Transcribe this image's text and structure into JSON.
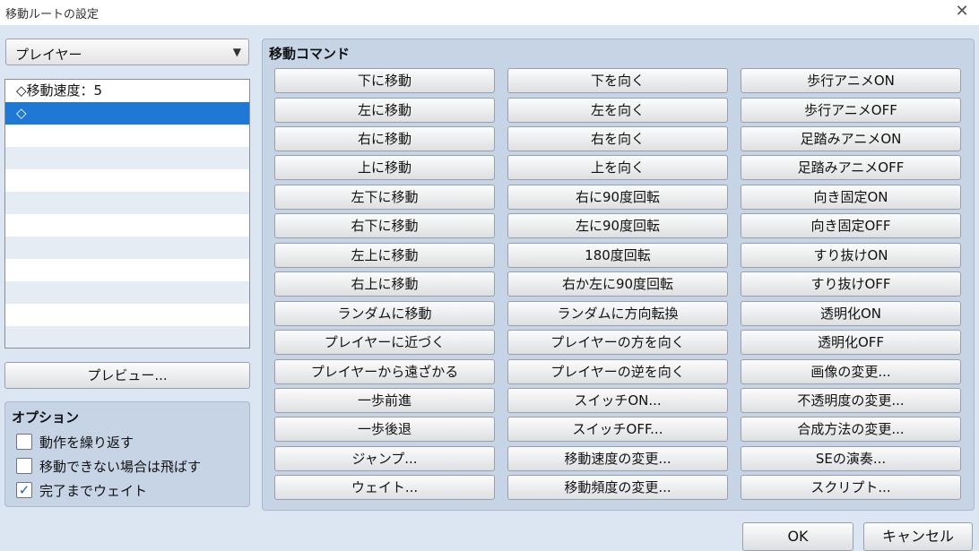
{
  "window": {
    "title": "移動ルートの設定",
    "close_glyph": "✕"
  },
  "target": {
    "selected": "プレイヤー",
    "arrow": "▼"
  },
  "route_list": {
    "items": [
      "◇移動速度：5",
      "◇",
      "",
      "",
      "",
      "",
      "",
      "",
      "",
      "",
      "",
      ""
    ],
    "selected_index": 1
  },
  "preview_label": "プレビュー...",
  "options": {
    "heading": "オプション",
    "items": [
      {
        "label": "動作を繰り返す",
        "checked": false
      },
      {
        "label": "移動できない場合は飛ばす",
        "checked": false
      },
      {
        "label": "完了までウェイト",
        "checked": true
      }
    ],
    "check_glyph": "✓"
  },
  "commands": {
    "heading": "移動コマンド",
    "columns": [
      [
        "下に移動",
        "左に移動",
        "右に移動",
        "上に移動",
        "左下に移動",
        "右下に移動",
        "左上に移動",
        "右上に移動",
        "ランダムに移動",
        "プレイヤーに近づく",
        "プレイヤーから遠ざかる",
        "一歩前進",
        "一歩後退",
        "ジャンプ...",
        "ウェイト..."
      ],
      [
        "下を向く",
        "左を向く",
        "右を向く",
        "上を向く",
        "右に90度回転",
        "左に90度回転",
        "180度回転",
        "右か左に90度回転",
        "ランダムに方向転換",
        "プレイヤーの方を向く",
        "プレイヤーの逆を向く",
        "スイッチON...",
        "スイッチOFF...",
        "移動速度の変更...",
        "移動頻度の変更..."
      ],
      [
        "歩行アニメON",
        "歩行アニメOFF",
        "足踏みアニメON",
        "足踏みアニメOFF",
        "向き固定ON",
        "向き固定OFF",
        "すり抜けON",
        "すり抜けOFF",
        "透明化ON",
        "透明化OFF",
        "画像の変更...",
        "不透明度の変更...",
        "合成方法の変更...",
        "SEの演奏...",
        "スクリプト..."
      ]
    ]
  },
  "footer": {
    "ok_label": "OK",
    "cancel_label": "キャンセル"
  }
}
